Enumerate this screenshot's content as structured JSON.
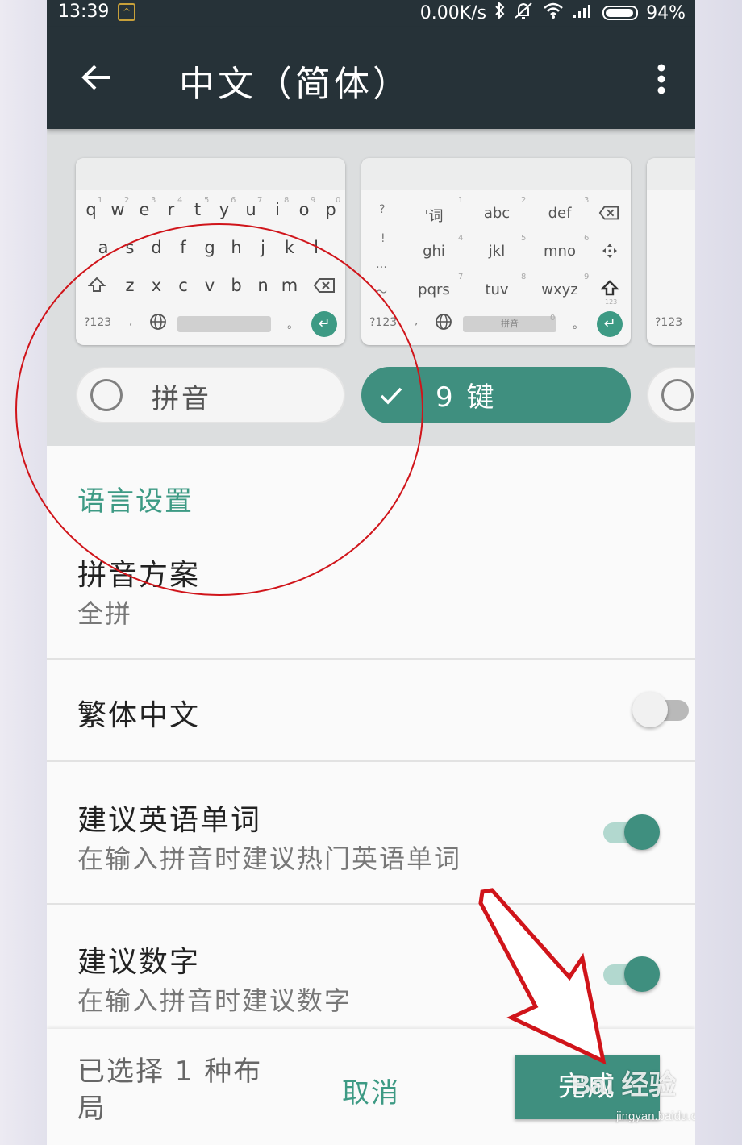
{
  "status_bar": {
    "time": "13:39",
    "network_speed": "0.00K/s",
    "battery": "94%"
  },
  "app_bar": {
    "title": "中文（简体）",
    "back_icon": "arrow-left-icon",
    "more_icon": "more-vert-icon"
  },
  "layouts": {
    "qwerty_preview": {
      "row1": [
        "q",
        "w",
        "e",
        "r",
        "t",
        "y",
        "u",
        "i",
        "o",
        "p"
      ],
      "row1_hints": [
        "1",
        "2",
        "3",
        "4",
        "5",
        "6",
        "7",
        "8",
        "9",
        "0"
      ],
      "row2": [
        "a",
        "s",
        "d",
        "f",
        "g",
        "h",
        "j",
        "k",
        "l"
      ],
      "row3": [
        "z",
        "x",
        "c",
        "v",
        "b",
        "n",
        "m"
      ],
      "symbols_key": "?123",
      "comma_key": ",",
      "period_key": "。"
    },
    "t9_preview": {
      "side_keys": [
        "?",
        "!",
        "…",
        "～"
      ],
      "keys": [
        "'词",
        "abc",
        "def",
        "ghi",
        "jkl",
        "mno",
        "pqrs",
        "tuv",
        "wxyz"
      ],
      "key_numbers": [
        "1",
        "2",
        "3",
        "4",
        "5",
        "6",
        "7",
        "8",
        "9"
      ],
      "small_123": "123",
      "symbols_key": "?123",
      "comma_key": ",",
      "space_label": "拼音",
      "space_hint": "0",
      "period_key": "。"
    },
    "third_preview": {
      "symbols_key": "?123"
    },
    "options": [
      {
        "label": "拼音",
        "selected": false
      },
      {
        "label": "9 键",
        "selected": true
      }
    ]
  },
  "settings": {
    "section_title": "语言设置",
    "pinyin_scheme": {
      "title": "拼音方案",
      "value": "全拼"
    },
    "traditional": {
      "title": "繁体中文",
      "enabled": false
    },
    "suggest_english": {
      "title": "建议英语单词",
      "subtitle": "在输入拼音时建议热门英语单词",
      "enabled": true
    },
    "suggest_numbers": {
      "title": "建议数字",
      "subtitle": "在输入拼音时建议数字",
      "enabled": true
    }
  },
  "bottom_bar": {
    "selected_text": "已选择 1 种布局",
    "cancel_label": "取消",
    "done_label": "完成"
  },
  "watermark": {
    "brand": "Bai 经验",
    "url": "jingyan.baidu.com"
  },
  "colors": {
    "accent": "#3f8f7f",
    "app_bar": "#263238",
    "annotation_red": "#d0141a"
  }
}
